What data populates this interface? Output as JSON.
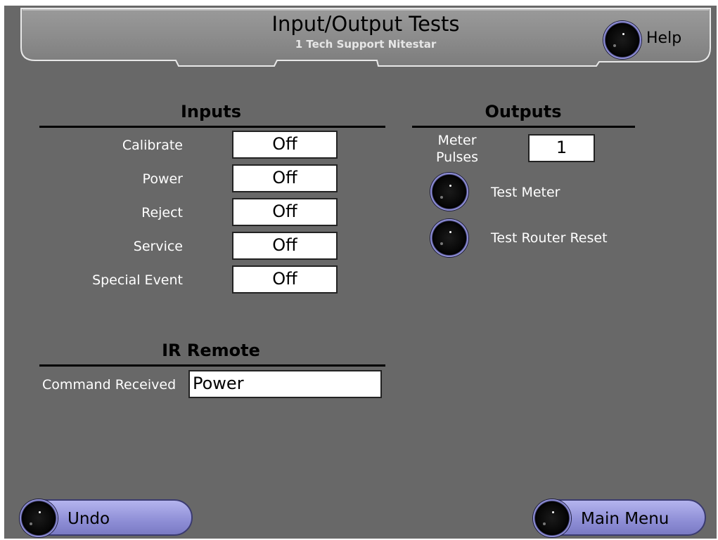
{
  "header": {
    "title": "Input/Output Tests",
    "subtitle": "1 Tech Support Nitestar",
    "help_label": "Help"
  },
  "inputs": {
    "heading": "Inputs",
    "rows": [
      {
        "label": "Calibrate",
        "value": "Off"
      },
      {
        "label": "Power",
        "value": "Off"
      },
      {
        "label": "Reject",
        "value": "Off"
      },
      {
        "label": "Service",
        "value": "Off"
      },
      {
        "label": "Special Event",
        "value": "Off"
      }
    ]
  },
  "outputs": {
    "heading": "Outputs",
    "meter_label_line1": "Meter",
    "meter_label_line2": "Pulses",
    "meter_pulses_value": "1",
    "test_meter_label": "Test Meter",
    "test_router_reset_label": "Test Router Reset"
  },
  "ir_remote": {
    "heading": "IR Remote",
    "command_label": "Command Received",
    "command_value": "Power"
  },
  "footer": {
    "undo_label": "Undo",
    "main_menu_label": "Main Menu"
  },
  "colors": {
    "background": "#686868",
    "header": "#8a8a8a",
    "button_fill": "#9c9ce0"
  }
}
